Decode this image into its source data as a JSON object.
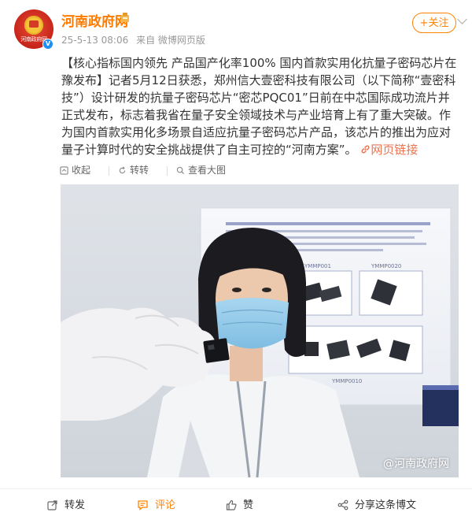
{
  "account": {
    "name": "河南政府网",
    "avatar_text": "河南政府网",
    "time": "25-5-13 08:06",
    "source": "来自 微博网页版",
    "follow_label": "+关注"
  },
  "post": {
    "text": "【核心指标国内领先 产品国产化率100% 国内首款实用化抗量子密码芯片在豫发布】记者5月12日获悉，郑州信大壹密科技有限公司（以下简称“壹密科技”）设计研发的抗量子密码芯片“密芯PQC01”日前在中芯国际成功流片并正式发布，标志着我省在量子安全领域技术与产业培育上有了重大突破。作为国内首款实用化多场景自适应抗量子密码芯片产品，该芯片的推出为应对量子计算时代的安全挑战提供了自主可控的“河南方案”。",
    "link_icon": "link-icon",
    "link_label": "网页链接"
  },
  "toolbar": {
    "collect": "收起",
    "repost": "转转",
    "view_large": "查看大图"
  },
  "photo": {
    "watermark": "@河南政府网",
    "board_chips": [
      "YMMP001",
      "YMMP0020",
      "YMMP0010"
    ]
  },
  "actions": {
    "forward": "转发",
    "comment": "评论",
    "like": "赞",
    "share": "分享这条博文"
  },
  "colors": {
    "brand_orange": "#ff8200",
    "link": "#eb7350"
  }
}
